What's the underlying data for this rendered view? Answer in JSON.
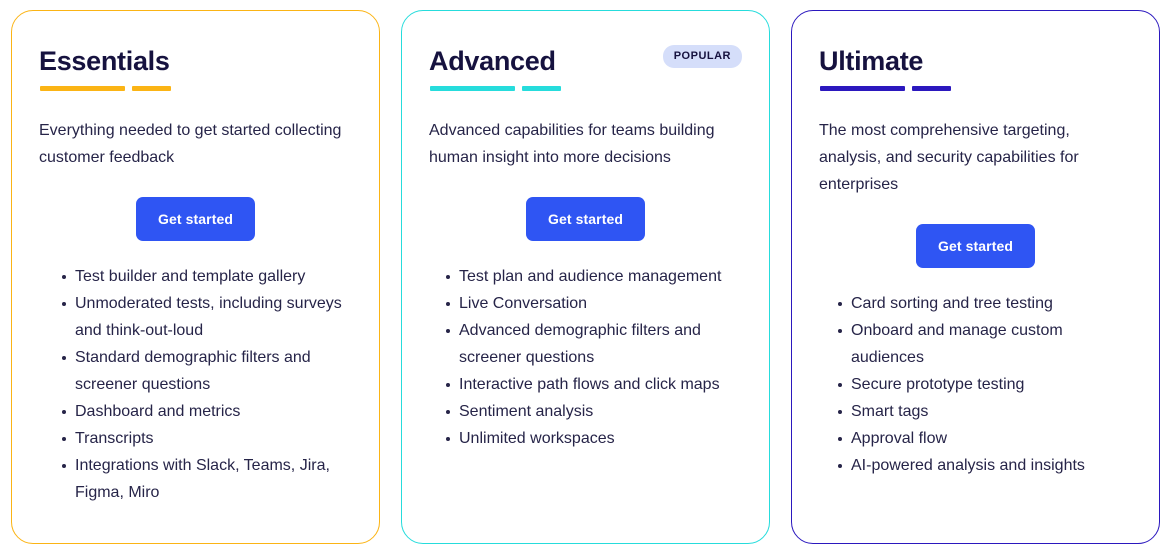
{
  "colors": {
    "essentials_accent": "#FBB415",
    "advanced_accent": "#26DCDC",
    "ultimate_accent": "#2B18BE",
    "cta_blue": "#2F55F3",
    "badge_bg": "#D5DEFA",
    "title_navy": "#16123F",
    "body_navy": "#262448",
    "page_bg": "#FFFFFF"
  },
  "plans": [
    {
      "id": "essentials",
      "title": "Essentials",
      "badge": null,
      "description": "Everything needed to get started collecting customer feedback",
      "cta_label": "Get started",
      "features": [
        "Test builder and template gallery",
        "Unmoderated tests, including surveys and think-out-loud",
        "Standard demographic filters and screener questions",
        "Dashboard and metrics",
        "Transcripts",
        "Integrations with Slack, Teams, Jira, Figma, Miro"
      ]
    },
    {
      "id": "advanced",
      "title": "Advanced",
      "badge": "POPULAR",
      "description": "Advanced capabilities for teams building human insight into more decisions",
      "cta_label": "Get started",
      "features": [
        "Test plan and audience management",
        "Live Conversation",
        "Advanced demographic filters and screener questions",
        "Interactive path flows and click maps",
        "Sentiment analysis",
        "Unlimited workspaces"
      ]
    },
    {
      "id": "ultimate",
      "title": "Ultimate",
      "badge": null,
      "description": "The most comprehensive targeting, analysis, and security capabilities for enterprises",
      "cta_label": "Get started",
      "features": [
        "Card sorting and tree testing",
        "Onboard and manage custom audiences",
        "Secure prototype testing",
        "Smart tags",
        "Approval flow",
        "AI-powered analysis and insights"
      ]
    }
  ]
}
